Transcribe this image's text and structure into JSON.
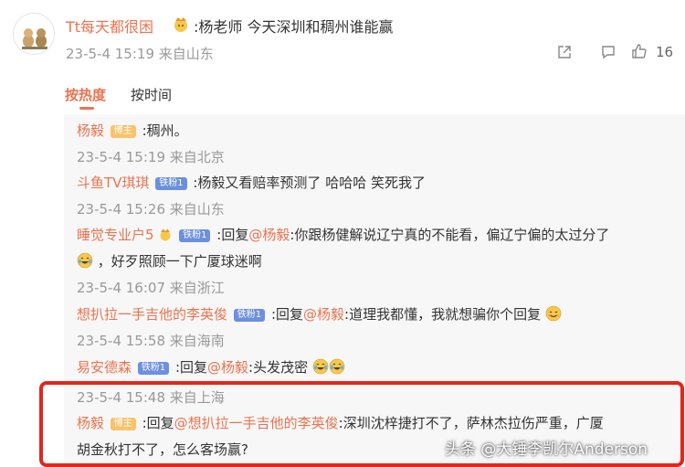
{
  "main_comment": {
    "username": "Tt每天都很困",
    "text": ":杨老师 今天深圳和稠州谁能赢",
    "meta": "23-5-4 15:19 来自山东",
    "like_count": "16"
  },
  "tabs": {
    "hot": "按热度",
    "time": "按时间"
  },
  "replies": [
    {
      "username": "杨毅",
      "badge": "博主",
      "text": ":稠州。",
      "meta": "23-5-4 15:19 来自北京"
    },
    {
      "username": "斗鱼TV琪琪",
      "badge": "铁粉1",
      "text": ":杨毅又看赔率预测了 哈哈哈 笑死我了",
      "meta": "23-5-4 15:26 来自山东"
    },
    {
      "username": "睡觉专业户5",
      "badge": "铁粉1",
      "prefix": ":回复",
      "at": "@杨毅",
      "text": ":你跟杨健解说辽宁真的不能看，偏辽宁偏的太过分了",
      "text2": "，好歹照顾一下广厦球迷啊",
      "meta": "23-5-4 16:07 来自浙江"
    },
    {
      "username": "想扒拉一手吉他的李英俊",
      "badge": "铁粉1",
      "prefix": ":回复",
      "at": "@杨毅",
      "text": ":道理我都懂，我就想骗你个回复",
      "meta": "23-5-4 15:58 来自海南"
    },
    {
      "username": "易安德森",
      "badge": "铁粉1",
      "prefix": ":回复",
      "at": "@杨毅",
      "text": ":头发茂密",
      "meta": "23-5-4 15:48 来自上海"
    },
    {
      "username": "杨毅",
      "badge": "博主",
      "prefix": ":回复",
      "at": "@想扒拉一手吉他的李英俊",
      "text": ":深圳沈梓捷打不了，萨林杰拉伤严重，广厦",
      "text2": "胡金秋打不了，怎么客场赢?"
    }
  ],
  "watermark": "头条 @大锤李凯尔Anderson",
  "colors": {
    "accent": "#eb7350",
    "meta": "#999999",
    "highlight_border": "#e0271e",
    "reply_bg": "#f7f7f7",
    "fan_badge": "#6c8fe0",
    "host_badge": "#f9c36b"
  },
  "icons": [
    "avatar-cats",
    "vip-crown-icon",
    "share-icon",
    "comment-icon",
    "like-icon",
    "laugh-cry-emoji",
    "smile-emoji"
  ]
}
